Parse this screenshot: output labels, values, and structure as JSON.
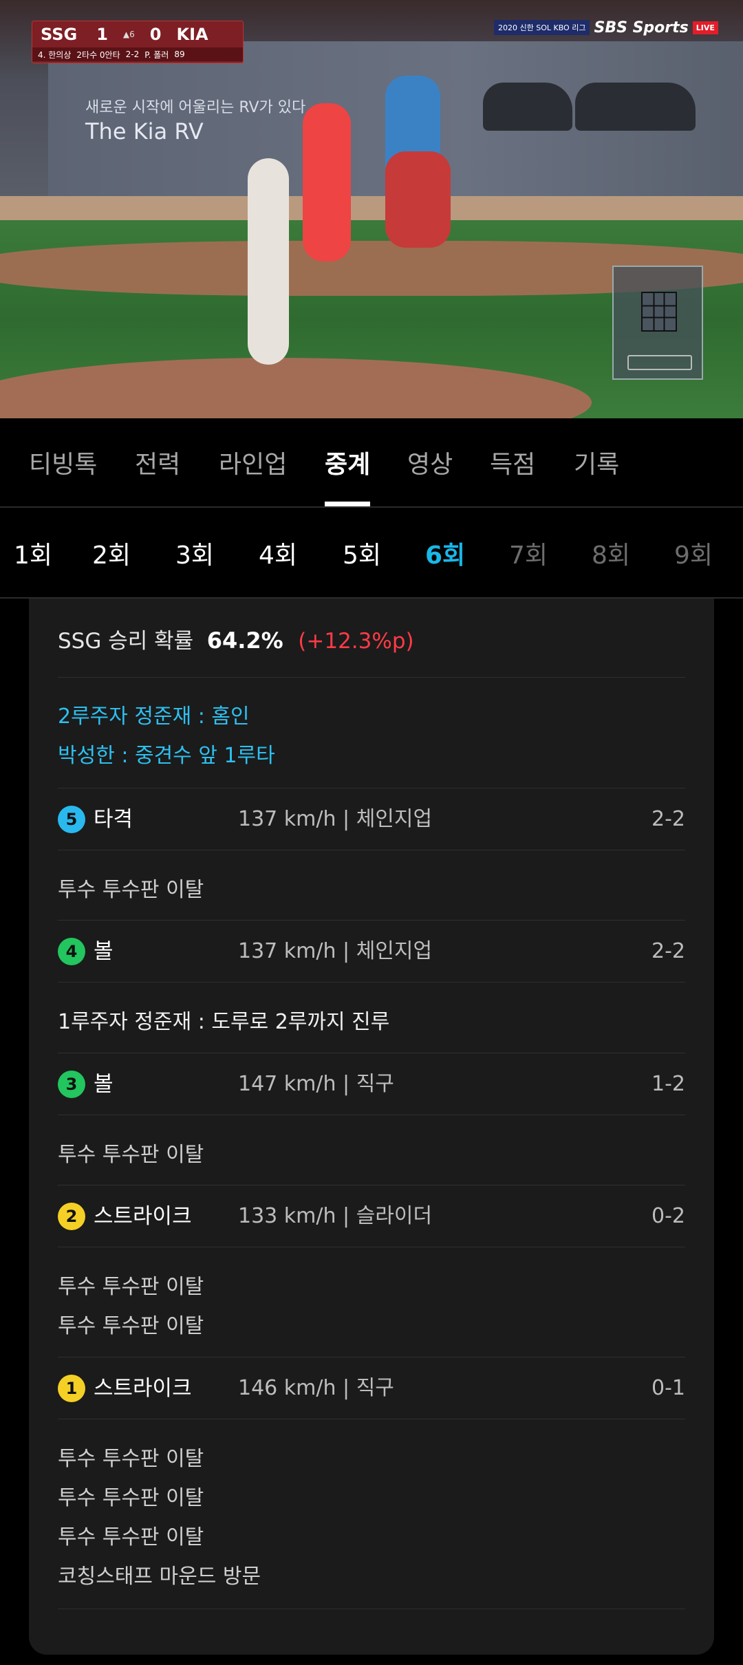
{
  "video": {
    "scoreboard": {
      "away_team": "SSG",
      "away_score": "1",
      "home_team": "KIA",
      "home_score": "0",
      "inning": "▲6",
      "batter": "4. 한의상",
      "batter_stat": "2타수 0안타",
      "count": "2-2",
      "pitcher": "P. 폴러",
      "pitch_count": "89"
    },
    "broadcast": {
      "league": "2020 신한 SOL KBO 리그",
      "network": "SBS Sports",
      "live": "LIVE"
    },
    "ad": {
      "line1": "새로운 시작에 어울리는 RV가 있다",
      "line2": "The Kia RV"
    }
  },
  "main_tabs": [
    {
      "label": "티빙톡"
    },
    {
      "label": "전력"
    },
    {
      "label": "라인업"
    },
    {
      "label": "중계"
    },
    {
      "label": "영상"
    },
    {
      "label": "득점"
    },
    {
      "label": "기록"
    }
  ],
  "inning_tabs": [
    {
      "label": "1회"
    },
    {
      "label": "2회"
    },
    {
      "label": "3회"
    },
    {
      "label": "4회"
    },
    {
      "label": "5회"
    },
    {
      "label": "6회"
    },
    {
      "label": "7회"
    },
    {
      "label": "8회"
    },
    {
      "label": "9회"
    }
  ],
  "active_main_tab": "중계",
  "active_inning": "6회",
  "win_prob": {
    "label": "SSG 승리 확률",
    "value": "64.2%",
    "delta": "(+12.3%p)",
    "delta_color": "#ff3b46"
  },
  "events": {
    "highlight1": "2루주자 정준재 : 홈인",
    "highlight2": "박성한 : 중견수 앞 1루타"
  },
  "pitches": [
    {
      "num": "5",
      "result": "타격",
      "info": "137 km/h | 체인지업",
      "count": "2-2",
      "color": "#29b9ee"
    },
    {
      "num": "4",
      "result": "볼",
      "info": "137 km/h | 체인지업",
      "count": "2-2",
      "color": "#22c55e"
    },
    {
      "num": "3",
      "result": "볼",
      "info": "147 km/h | 직구",
      "count": "1-2",
      "color": "#22c55e"
    },
    {
      "num": "2",
      "result": "스트라이크",
      "info": "133 km/h | 슬라이더",
      "count": "0-2",
      "color": "#f4cf26"
    },
    {
      "num": "1",
      "result": "스트라이크",
      "info": "146 km/h | 직구",
      "count": "0-1",
      "color": "#f4cf26"
    }
  ],
  "notes": {
    "after5": "투수 투수판 이탈",
    "after4": "1루주자 정준재 : 도루로 2루까지 진루",
    "after3": "투수 투수판 이탈",
    "after2": [
      "투수 투수판 이탈",
      "투수 투수판 이탈"
    ],
    "after1": [
      "투수 투수판 이탈",
      "투수 투수판 이탈",
      "투수 투수판 이탈",
      "코칭스태프 마운드 방문"
    ]
  }
}
